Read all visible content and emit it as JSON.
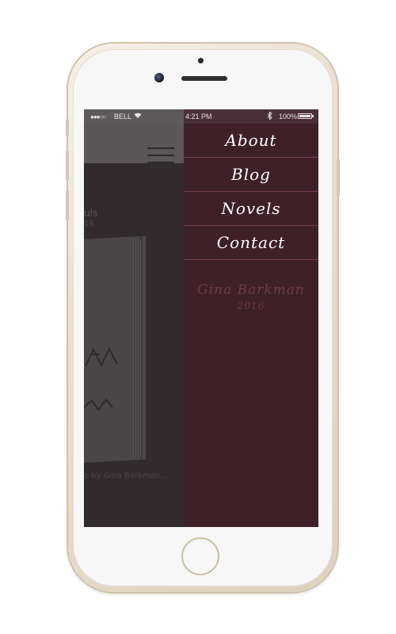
{
  "statusbar": {
    "signal_glyph": "●●●○○",
    "carrier": "BELL",
    "wifi_icon": "wifi-icon",
    "time": "4:21 PM",
    "bluetooth_icon": "bluetooth-icon",
    "battery_percent": "100%"
  },
  "background_app": {
    "title_fragment": "uls",
    "subtitle_fragment": "16",
    "caption_fragment": "e by Gina Barkman..."
  },
  "menu": {
    "items": [
      {
        "label": "About"
      },
      {
        "label": "Blog"
      },
      {
        "label": "Novels"
      },
      {
        "label": "Contact"
      }
    ],
    "author": "Gina Barkman",
    "year": "2016"
  },
  "colors": {
    "menu_bg": "#3e2028",
    "menu_divider": "#7a3e52",
    "author_text": "#6e3a48",
    "phone_gold": "#e9dfcf"
  }
}
